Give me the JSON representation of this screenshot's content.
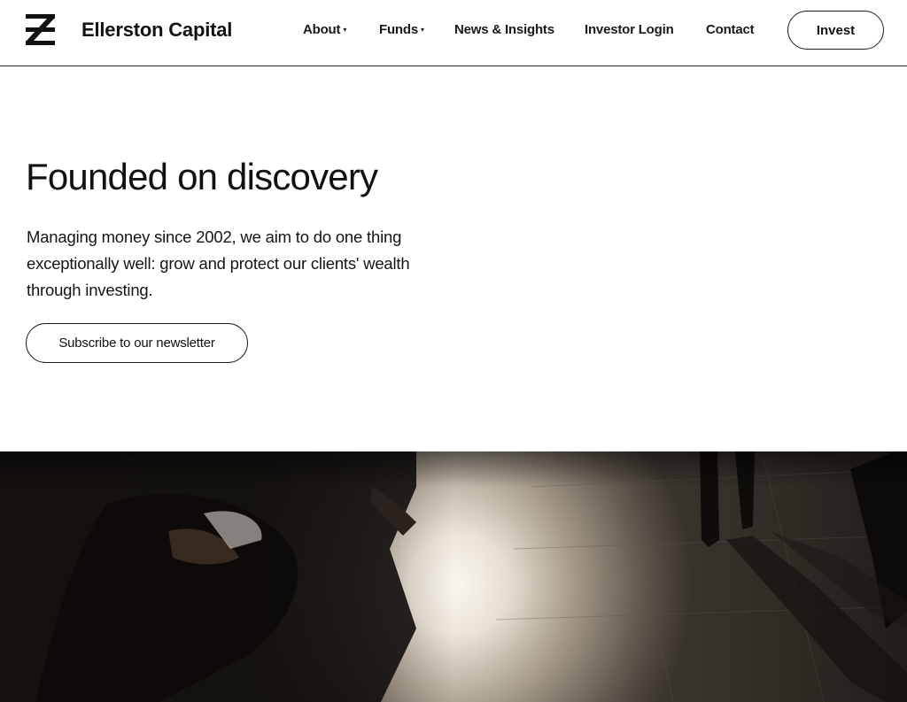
{
  "brand": {
    "name": "Ellerston Capital",
    "logo_icon": "z-monogram-icon"
  },
  "nav": {
    "items": [
      {
        "label": "About",
        "has_dropdown": true
      },
      {
        "label": "Funds",
        "has_dropdown": true
      },
      {
        "label": "News & Insights",
        "has_dropdown": false
      },
      {
        "label": "Investor Login",
        "has_dropdown": false
      },
      {
        "label": "Contact",
        "has_dropdown": false
      }
    ],
    "caret": "▾",
    "cta_label": "Invest"
  },
  "hero": {
    "title": "Founded on discovery",
    "body": "Managing money since 2002, we aim to do one thing exceptionally well: grow and protect our clients' wealth through investing.",
    "button_label": "Subscribe to our newsletter"
  },
  "colors": {
    "text": "#111111",
    "background": "#ffffff",
    "border": "#1c1c1c",
    "photo_dark": "#1a1714",
    "photo_light": "#f4efe6"
  }
}
